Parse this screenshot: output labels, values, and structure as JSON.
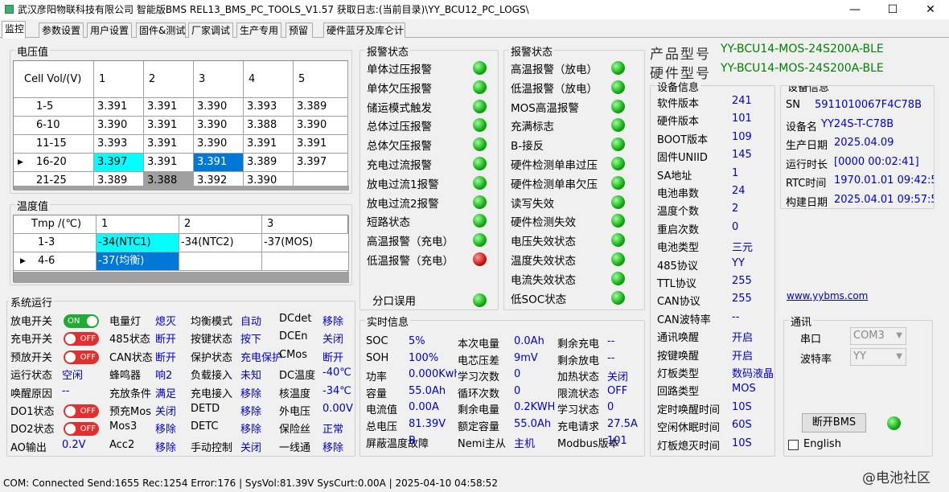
{
  "window": {
    "title": "武汉彦阳物联科技有限公司  智能版BMS   REL13_BMS_PC_TOOLS_V1.57     获取日志:(当前目录)\\YY_BCU12_PC_LOGS\\",
    "min": "—",
    "max": "☐",
    "close": "✕"
  },
  "tabs": [
    "监控",
    "参数设置",
    "用户设置",
    "固件&测试",
    "厂家调试",
    "生产专用",
    "预留",
    "硬件蓝牙及库仑计"
  ],
  "voltage": {
    "title": "电压值",
    "headers": [
      "Cell Vol/(V)",
      "1",
      "2",
      "3",
      "4",
      "5"
    ],
    "rows": [
      [
        "1-5",
        "3.391",
        "3.391",
        "3.390",
        "3.393",
        "3.389"
      ],
      [
        "6-10",
        "3.390",
        "3.391",
        "3.390",
        "3.388",
        "3.390"
      ],
      [
        "11-15",
        "3.393",
        "3.391",
        "3.390",
        "3.391",
        "3.391"
      ],
      [
        "16-20",
        "3.397",
        "3.391",
        "3.391",
        "3.389",
        "3.397"
      ],
      [
        "21-25",
        "3.389",
        "3.388",
        "3.392",
        "3.390",
        ""
      ]
    ]
  },
  "temperature": {
    "title": "温度值",
    "headers": [
      "Tmp /(℃)",
      "1",
      "2",
      "3"
    ],
    "rows": [
      [
        "1-3",
        "-34(NTC1)",
        "-34(NTC2)",
        "-37(MOS)"
      ],
      [
        "4-6",
        "-37(均衡)",
        "",
        ""
      ]
    ]
  },
  "system": {
    "title": "系统运行",
    "col1": [
      {
        "label": "放电开关",
        "toggle": "ON"
      },
      {
        "label": "充电开关",
        "toggle": "OFF"
      },
      {
        "label": "预放开关",
        "toggle": "OFF"
      },
      {
        "label": "运行状态",
        "value": "空闲"
      },
      {
        "label": "唤醒原因",
        "value": "--"
      },
      {
        "label": "DO1状态",
        "toggle": "OFF"
      },
      {
        "label": "DO2状态",
        "toggle": "OFF"
      },
      {
        "label": "AO输出",
        "value": "0.2V"
      }
    ],
    "col2": [
      {
        "label": "电量灯",
        "value": "熄灭"
      },
      {
        "label": "485状态",
        "value": "断开"
      },
      {
        "label": "CAN状态",
        "value": "断开"
      },
      {
        "label": "蜂鸣器",
        "value": "响2"
      },
      {
        "label": "充放条件",
        "value": "满足"
      },
      {
        "label": "预充Mos",
        "value": "关闭"
      },
      {
        "label": "Mos3",
        "value": "移除"
      },
      {
        "label": "Acc2",
        "value": "移除"
      }
    ],
    "col3": [
      {
        "label": "均衡模式",
        "value": "自动"
      },
      {
        "label": "按键状态",
        "value": "按下"
      },
      {
        "label": "保护状态",
        "value": "充电保护"
      },
      {
        "label": "负载接入",
        "value": "未知"
      },
      {
        "label": "充电接入",
        "value": "移除"
      },
      {
        "label": "DETD",
        "value": "移除"
      },
      {
        "label": "DETC",
        "value": "移除"
      },
      {
        "label": "手动控制",
        "value": "关闭"
      }
    ],
    "col4": [
      {
        "label": "DCdet",
        "value": "移除"
      },
      {
        "label": "DCEn",
        "value": "关闭"
      },
      {
        "label": "CMos",
        "value": "断开"
      },
      {
        "label": "DC温度",
        "value": "-40℃"
      },
      {
        "label": "核温度",
        "value": "-34℃"
      },
      {
        "label": "外电压",
        "value": "0.00V"
      },
      {
        "label": "保险丝",
        "value": "正常"
      },
      {
        "label": "一线通",
        "value": "移除"
      }
    ],
    "on_text": "ON",
    "off_text": "OFF"
  },
  "alarm1": {
    "title": "报警状态",
    "items": [
      {
        "label": "单体过压报警",
        "state": "green"
      },
      {
        "label": "单体欠压报警",
        "state": "green"
      },
      {
        "label": "储运模式触发",
        "state": "green"
      },
      {
        "label": "总体过压报警",
        "state": "green"
      },
      {
        "label": "总体欠压报警",
        "state": "green"
      },
      {
        "label": "充电过流报警",
        "state": "green"
      },
      {
        "label": "放电过流1报警",
        "state": "green"
      },
      {
        "label": "放电过流2报警",
        "state": "green"
      },
      {
        "label": "短路状态",
        "state": "green"
      },
      {
        "label": "高温报警（充电）",
        "state": "green"
      },
      {
        "label": "低温报警（充电）",
        "state": "red"
      }
    ],
    "extra": {
      "label": "分口误用",
      "state": "green"
    }
  },
  "alarm2": {
    "title": "报警状态",
    "items": [
      {
        "label": "高温报警（放电）",
        "state": "green"
      },
      {
        "label": "低温报警（放电）",
        "state": "green"
      },
      {
        "label": "MOS高温报警",
        "state": "green"
      },
      {
        "label": "充满标志",
        "state": "green"
      },
      {
        "label": "B-接反",
        "state": "green"
      },
      {
        "label": "硬件检测单串过压",
        "state": "green"
      },
      {
        "label": "硬件检测单串欠压",
        "state": "green"
      },
      {
        "label": "读写失效",
        "state": "green"
      },
      {
        "label": "硬件检测失效",
        "state": "green"
      },
      {
        "label": "电压失效状态",
        "state": "green"
      },
      {
        "label": "温度失效状态",
        "state": "green"
      },
      {
        "label": "电流失效状态",
        "state": "green"
      },
      {
        "label": "低SOC状态",
        "state": "green"
      }
    ]
  },
  "realtime": {
    "title": "实时信息",
    "col1": [
      {
        "label": "SOC",
        "value": "5%"
      },
      {
        "label": "SOH",
        "value": "100%"
      },
      {
        "label": "功率",
        "value": "0.000Kwh"
      },
      {
        "label": "容量",
        "value": "55.0Ah"
      },
      {
        "label": "电流值",
        "value": "0.00A"
      },
      {
        "label": "总电压",
        "value": "81.39V"
      },
      {
        "label": "屏蔽温度故障",
        "value": "B"
      }
    ],
    "col2": [
      {
        "label": "本次电量",
        "value": "0.0Ah"
      },
      {
        "label": "电芯压差",
        "value": "9mV"
      },
      {
        "label": "学习次数",
        "value": "0"
      },
      {
        "label": "循环次数",
        "value": "0"
      },
      {
        "label": "剩余电量",
        "value": "0.2KWH"
      },
      {
        "label": "额定容量",
        "value": "55.0Ah"
      },
      {
        "label": "Nemi主从",
        "value": "主机"
      }
    ],
    "col3": [
      {
        "label": "剩余充电",
        "value": "--"
      },
      {
        "label": "剩余放电",
        "value": "--"
      },
      {
        "label": "加热状态",
        "value": "关闭"
      },
      {
        "label": "限流状态",
        "value": "OFF"
      },
      {
        "label": "学习状态",
        "value": "0"
      },
      {
        "label": "充电请求",
        "value": "27.5A"
      },
      {
        "label": "Modbus版本",
        "value": "101"
      }
    ]
  },
  "product": {
    "model_label": "产品型号",
    "model_value": "YY-BCU14-MOS-24S200A-BLE",
    "hw_label": "硬件型号",
    "hw_value": "YY-BCU14-MOS-24S200A-BLE"
  },
  "devinfo1": {
    "title": "设备信息",
    "items": [
      {
        "label": "软件版本",
        "value": "241"
      },
      {
        "label": "硬件版本",
        "value": "101"
      },
      {
        "label": "BOOT版本",
        "value": "109"
      },
      {
        "label": "固件UNIID",
        "value": "145"
      },
      {
        "label": "SA地址",
        "value": "1"
      },
      {
        "label": "电池串数",
        "value": "24"
      },
      {
        "label": "温度个数",
        "value": "2"
      },
      {
        "label": "重启次数",
        "value": "0"
      },
      {
        "label": "电池类型",
        "value": "三元"
      },
      {
        "label": "485协议",
        "value": "YY"
      },
      {
        "label": "TTL协议",
        "value": "255"
      },
      {
        "label": "CAN协议",
        "value": "255"
      },
      {
        "label": "CAN波特率",
        "value": "--"
      },
      {
        "label": "通讯唤醒",
        "value": "开启"
      },
      {
        "label": "按键唤醒",
        "value": "开启"
      },
      {
        "label": "灯板类型",
        "value": "数码液晶"
      },
      {
        "label": "回路类型",
        "value": "MOS"
      },
      {
        "label": "定时唤醒时间",
        "value": "10S"
      },
      {
        "label": "空闲休眠时间",
        "value": "60S"
      },
      {
        "label": "灯板熄灭时间",
        "value": "10S"
      }
    ]
  },
  "devinfo2": {
    "title": "设备信息",
    "items": [
      {
        "label": "SN",
        "value": "5911010067F4C78B"
      },
      {
        "label": "设备名",
        "value": "YY24S-T-C78B"
      },
      {
        "label": "生产日期",
        "value": "2025.04.09"
      },
      {
        "label": "运行时长",
        "value": "[0000 00:02:41]"
      },
      {
        "label": "RTC时间",
        "value": "1970.01.01 09:42:51"
      },
      {
        "label": "构建日期",
        "value": "2025.04.01 09:57:51"
      }
    ]
  },
  "link": "www.yybms.com",
  "comm": {
    "title": "通讯",
    "port_label": "串口",
    "port_value": "COM3",
    "baud_label": "波特率",
    "baud_value": "YY",
    "disconnect": "断开BMS",
    "english": "English"
  },
  "watermark": "@电池社区",
  "statusbar": "COM:  Connected  Send:1655  Rec:1254  Error:176  | SysVol:81.39V  SysCurt:0.00A | 2025-04-10 04:58:52",
  "colors": {
    "cyan": "#00ffff",
    "blue": "#0078d7",
    "gray": "#a0a0a0",
    "value": "#0000cc",
    "green_text": "#008000"
  }
}
